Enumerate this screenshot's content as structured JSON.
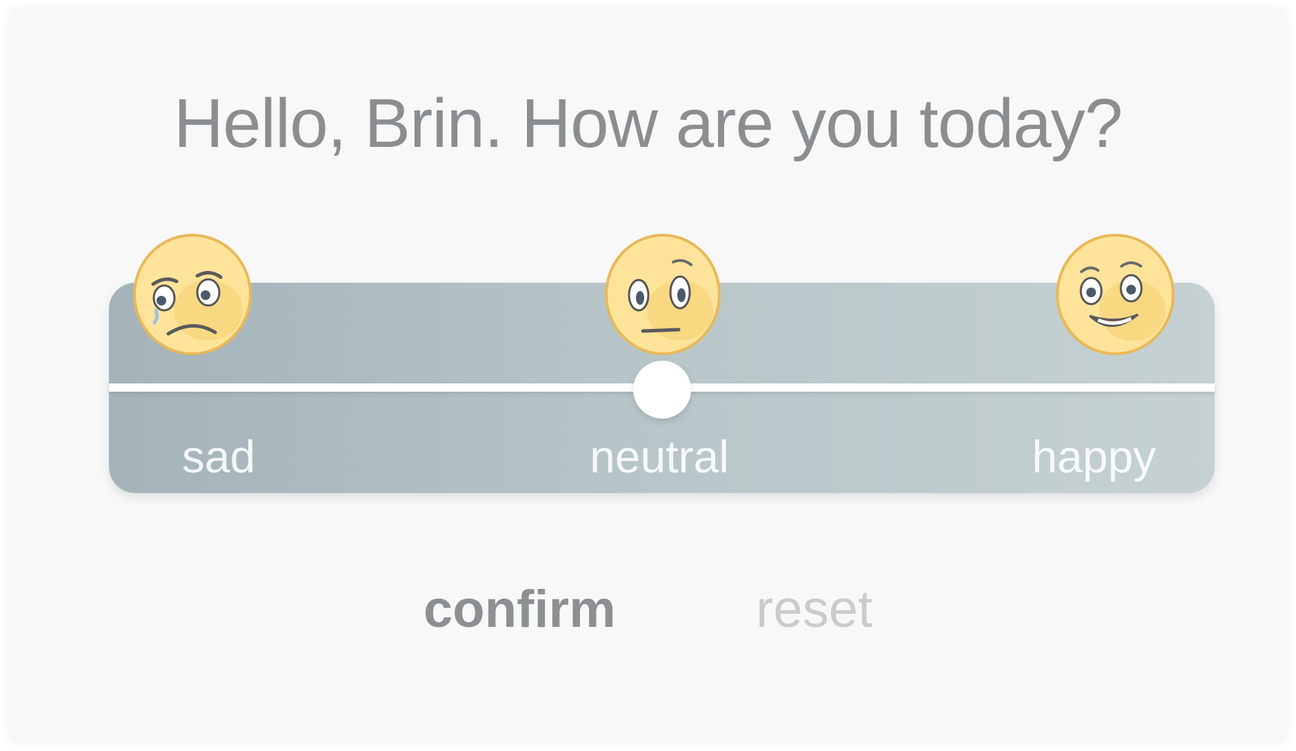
{
  "greeting": "Hello, Brin. How are you today?",
  "mood_slider": {
    "stops": [
      {
        "label": "sad",
        "icon": "sad-face-icon"
      },
      {
        "label": "neutral",
        "icon": "neutral-face-icon"
      },
      {
        "label": "happy",
        "icon": "happy-face-icon"
      }
    ],
    "selected": "neutral",
    "value_fraction": 0.5
  },
  "actions": {
    "confirm_label": "confirm",
    "reset_label": "reset"
  },
  "colors": {
    "text": "#8b8e91",
    "confirm": "#8d9093",
    "reset": "#c9cbcd",
    "panel_left": "#a4b3ba",
    "panel_right": "#c5d1d2",
    "face_fill": "#fde49a",
    "face_stroke": "#e8b85a"
  }
}
